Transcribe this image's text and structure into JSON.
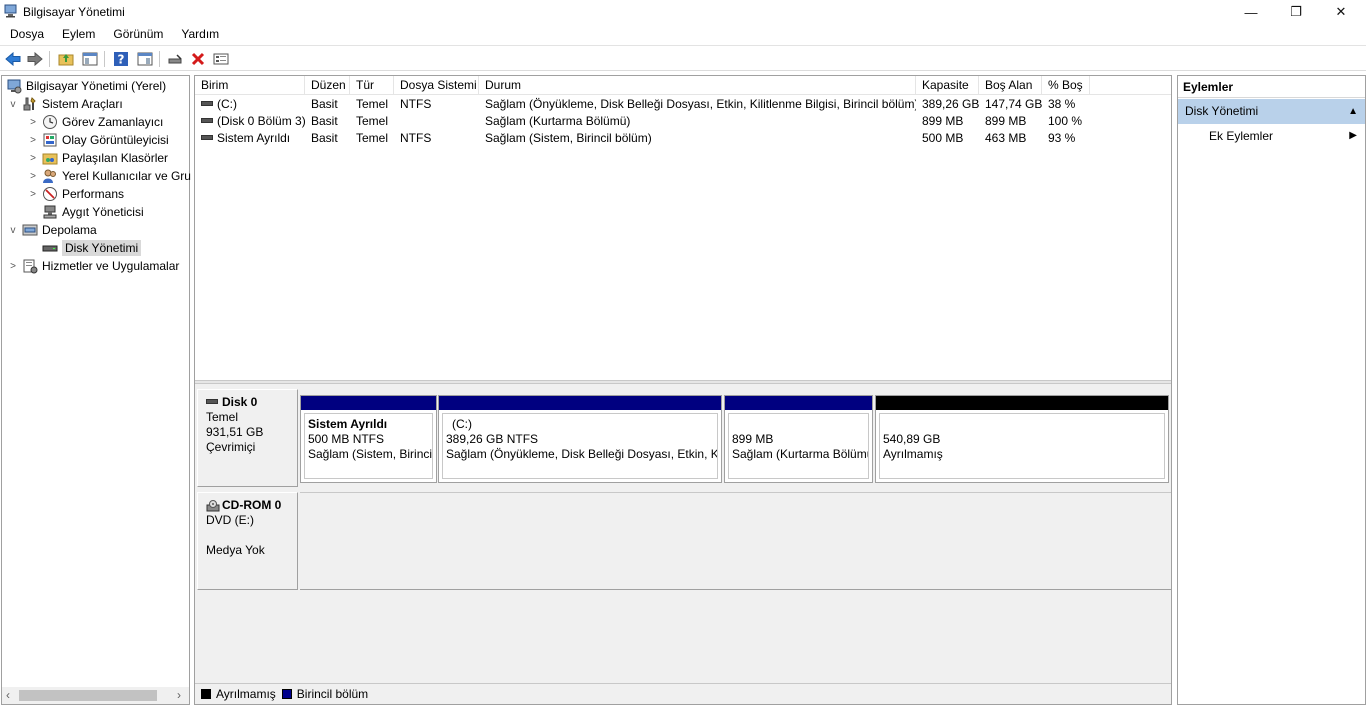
{
  "window": {
    "title": "Bilgisayar Yönetimi",
    "controls": {
      "minimize": "—",
      "restore": "❐",
      "close": "✕"
    }
  },
  "menu": [
    "Dosya",
    "Eylem",
    "Görünüm",
    "Yardım"
  ],
  "toolbar_icons": [
    "back-arrow-icon",
    "forward-arrow-icon",
    "up-folder-icon",
    "show-hide-tree-icon",
    "help-icon",
    "action-pane-icon",
    "connect-icon",
    "delete-icon",
    "properties-icon"
  ],
  "tree": {
    "root": "Bilgisayar Yönetimi (Yerel)",
    "system_tools": "Sistem Araçları",
    "task_scheduler": "Görev Zamanlayıcı",
    "event_viewer": "Olay Görüntüleyicisi",
    "shared_folders": "Paylaşılan Klasörler",
    "local_users": "Yerel Kullanıcılar ve Gru",
    "performance": "Performans",
    "device_manager": "Aygıt Yöneticisi",
    "storage": "Depolama",
    "disk_management": "Disk Yönetimi",
    "services": "Hizmetler ve Uygulamalar"
  },
  "volume_table": {
    "columns": [
      "Birim",
      "Düzen",
      "Tür",
      "Dosya Sistemi",
      "Durum",
      "Kapasite",
      "Boş Alan",
      "% Boş"
    ],
    "rows": [
      {
        "volume": "(C:)",
        "layout": "Basit",
        "type": "Temel",
        "fs": "NTFS",
        "status": "Sağlam (Önyükleme, Disk Belleği Dosyası, Etkin, Kilitlenme Bilgisi, Birincil bölüm)",
        "capacity": "389,26 GB",
        "free": "147,74 GB",
        "pct": "38 %"
      },
      {
        "volume": "(Disk 0 Bölüm 3)",
        "layout": "Basit",
        "type": "Temel",
        "fs": "",
        "status": "Sağlam (Kurtarma Bölümü)",
        "capacity": "899 MB",
        "free": "899 MB",
        "pct": "100 %"
      },
      {
        "volume": "Sistem Ayrıldı",
        "layout": "Basit",
        "type": "Temel",
        "fs": "NTFS",
        "status": "Sağlam (Sistem, Birincil bölüm)",
        "capacity": "500 MB",
        "free": "463 MB",
        "pct": "93 %"
      }
    ]
  },
  "disk0": {
    "name": "Disk 0",
    "type": "Temel",
    "size": "931,51 GB",
    "state": "Çevrimiçi",
    "partitions": [
      {
        "name": "Sistem Ayrıldı",
        "size": "500 MB NTFS",
        "status": "Sağlam (Sistem, Birincil",
        "kind": "primary"
      },
      {
        "name": "(C:)",
        "size": "389,26 GB NTFS",
        "status": "Sağlam (Önyükleme, Disk Belleği Dosyası, Etkin, Kili",
        "kind": "primary"
      },
      {
        "name": "",
        "size": "899 MB",
        "status": "Sağlam (Kurtarma Bölümü",
        "kind": "primary"
      },
      {
        "name": "",
        "size": "540,89 GB",
        "status": "Ayrılmamış",
        "kind": "unallocated"
      }
    ]
  },
  "cdrom0": {
    "name": "CD-ROM 0",
    "type": "DVD (E:)",
    "state": "Medya Yok"
  },
  "legend": [
    {
      "label": "Ayrılmamış",
      "color": "#000000"
    },
    {
      "label": "Birincil bölüm",
      "color": "#00008b"
    }
  ],
  "colors": {
    "primary_bar": "#000080",
    "unallocated_bar": "#000000",
    "selection": "#b9d1ea"
  },
  "actions": {
    "title": "Eylemler",
    "section": "Disk Yönetimi",
    "item": "Ek Eylemler"
  }
}
